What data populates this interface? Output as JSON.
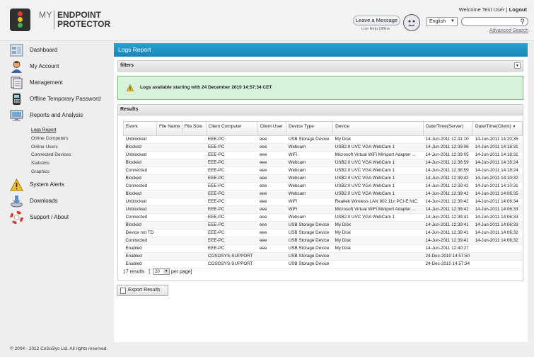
{
  "header": {
    "logo_my": "MY",
    "logo_line1": "ENDPOINT",
    "logo_line2": "PROTECTOR",
    "welcome_text": "Welcome Test User | ",
    "logout_label": "Logout",
    "leave_message_label": "Leave a Message",
    "help_status": "Live Help Offline",
    "language_value": "English",
    "search_value": "",
    "advanced_search_label": "Advanced Search"
  },
  "sidebar": {
    "items": [
      {
        "label": "Dashboard",
        "icon": "dashboard-icon"
      },
      {
        "label": "My Account",
        "icon": "user-icon"
      },
      {
        "label": "Management",
        "icon": "management-icon"
      },
      {
        "label": "Offline Temporary Password",
        "icon": "password-icon"
      },
      {
        "label": "Reports and Analysis",
        "icon": "reports-icon"
      },
      {
        "label": "System Alerts",
        "icon": "warning-icon"
      },
      {
        "label": "Downloads",
        "icon": "download-icon"
      },
      {
        "label": "Support / About",
        "icon": "support-icon"
      }
    ],
    "subitems": [
      "Logs Report",
      "Online Computers",
      "Online Users",
      "Connected Devices",
      "Statistics",
      "Graphics"
    ]
  },
  "main": {
    "title": "Logs Report",
    "filters_label": "filters",
    "notice": "Logs available starting with 24 December 2010 14:57:34 CET",
    "results_label": "Results",
    "columns": [
      "Event",
      "File Name",
      "File Size",
      "Client Computer",
      "Client User",
      "Device Type",
      "Device",
      "Date/Time(Server)",
      "Date/Time(Client)"
    ],
    "rows": [
      [
        "Unblocked",
        "",
        "",
        "EEE-PC",
        "eee",
        "USB Storage Device",
        "My Disk",
        "14-Jun-2011 12:41:10",
        "14-Jun-2011 14:20:35"
      ],
      [
        "Blocked",
        "",
        "",
        "EEE-PC",
        "eee",
        "Webcam",
        "USB2.0 UVC VGA WebCam 1",
        "14-Jun-2011 12:39:06",
        "14-Jun-2011 14:18:31"
      ],
      [
        "Unblocked",
        "",
        "",
        "EEE-PC",
        "eee",
        "WiFi",
        "Microsoft Virtual WiFi Miniport Adapter ...",
        "14-Jun-2011 12:39:05",
        "14-Jun-2011 14:18:31"
      ],
      [
        "Blocked",
        "",
        "",
        "EEE-PC",
        "eee",
        "Webcam",
        "USB2.0 UVC VGA WebCam 1",
        "14-Jun-2011 12:38:59",
        "14-Jun-2011 14:18:24"
      ],
      [
        "Connected",
        "",
        "",
        "EEE-PC",
        "eee",
        "Webcam",
        "USB2.0 UVC VGA WebCam 1",
        "14-Jun-2011 12:38:59",
        "14-Jun-2011 14:18:24"
      ],
      [
        "Blocked",
        "",
        "",
        "EEE-PC",
        "eee",
        "Webcam",
        "USB2.0 UVC VGA WebCam 1",
        "14-Jun-2011 12:39:42",
        "14-Jun-2011 14:10:32"
      ],
      [
        "Connected",
        "",
        "",
        "EEE-PC",
        "eee",
        "Webcam",
        "USB2.0 UVC VGA WebCam 1",
        "14-Jun-2011 12:39:42",
        "14-Jun-2011 14:10:31"
      ],
      [
        "Blocked",
        "",
        "",
        "EEE-PC",
        "eee",
        "Webcam",
        "USB2.0 UVC VGA WebCam 1",
        "14-Jun-2011 12:39:42",
        "14-Jun-2011 14:06:35"
      ],
      [
        "Unblocked",
        "",
        "",
        "EEE-PC",
        "eee",
        "WiFi",
        "Realtek Wireless LAN 802.11n PCI-E NIC",
        "14-Jun-2011 12:39:42",
        "14-Jun-2011 14:06:34"
      ],
      [
        "Unblocked",
        "",
        "",
        "EEE-PC",
        "eee",
        "WiFi",
        "Microsoft Virtual WiFi Miniport Adapter ...",
        "14-Jun-2011 12:39:42",
        "14-Jun-2011 14:06:33"
      ],
      [
        "Connected",
        "",
        "",
        "EEE-PC",
        "eee",
        "Webcam",
        "USB2.0 UVC VGA WebCam 1",
        "14-Jun-2011 12:39:41",
        "14-Jun-2011 14:06:33"
      ],
      [
        "Blocked",
        "",
        "",
        "EEE-PC",
        "eee",
        "USB Storage Device",
        "My Disk",
        "14-Jun-2011 12:39:41",
        "14-Jun-2011 14:06:33"
      ],
      [
        "Device not TD",
        "",
        "",
        "EEE-PC",
        "eee",
        "USB Storage Device",
        "My Disk",
        "14-Jun-2011 12:39:41",
        "14-Jun-2011 14:06:32"
      ],
      [
        "Connected",
        "",
        "",
        "EEE-PC",
        "eee",
        "USB Storage Device",
        "My Disk",
        "14-Jun-2011 12:39:41",
        "14-Jun-2011 14:06:32"
      ],
      [
        "Enabled",
        "",
        "",
        "EEE-PC",
        "eee",
        "USB Storage Device",
        "My Disk",
        "14-Jun-2011 12:40:27",
        ""
      ],
      [
        "Enabled",
        "",
        "",
        "COSOSYS-SUPPORT",
        "",
        "USB Storage Device",
        "",
        "24-Dec-2010 14:57:50",
        ""
      ],
      [
        "Enabled",
        "",
        "",
        "COSOSYS-SUPPORT",
        "",
        "USB Storage Device",
        "",
        "24-Dec-2010 14:57:34",
        ""
      ]
    ],
    "results_count_text": "17 results",
    "per_page_value": "20",
    "per_page_suffix": "per page]",
    "export_label": "Export Results"
  },
  "footer": "© 2004 - 2012 CoSoSys Ltd. All rights reserved.",
  "colors": {
    "accent": "#1f94c6",
    "notice_bg": "#d8f1da"
  }
}
